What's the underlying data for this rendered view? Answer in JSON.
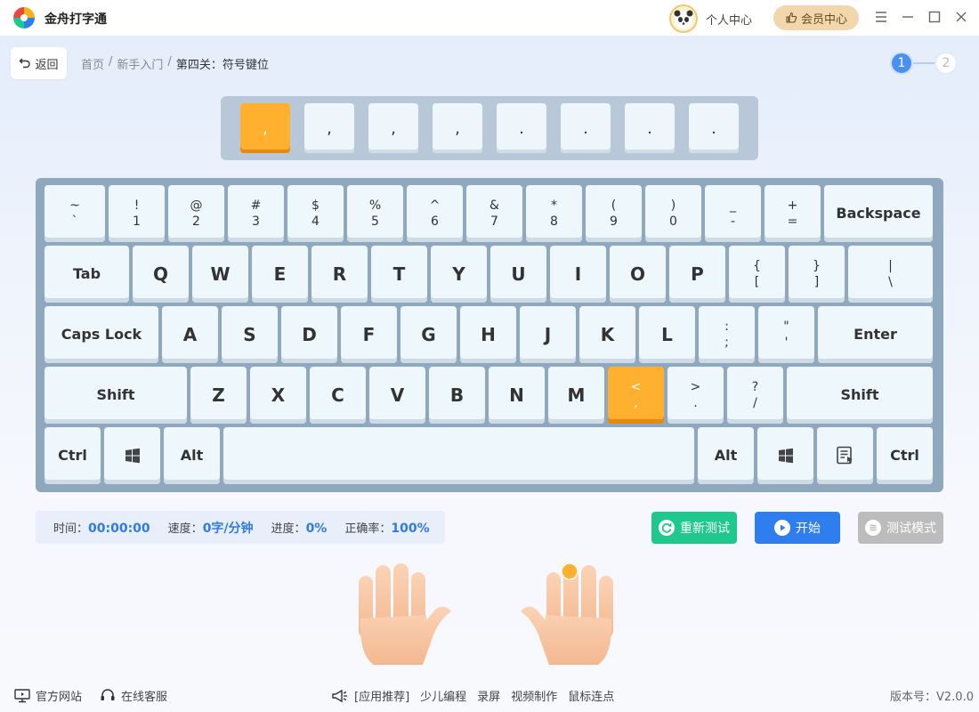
{
  "app": {
    "title": "金舟打字通"
  },
  "header": {
    "personal_label": "个人中心",
    "vip_label": "会员中心"
  },
  "nav": {
    "back_label": "返回",
    "breadcrumb": [
      "首页",
      "/",
      "新手入门",
      "/",
      "第四关：符号键位"
    ],
    "steps": [
      "1",
      "2"
    ],
    "current_step": 1
  },
  "practice": {
    "chars": [
      ",",
      ",",
      ",",
      ",",
      ".",
      ".",
      ".",
      "."
    ],
    "active_index": 0
  },
  "keyboard": {
    "row1": [
      {
        "top": "~",
        "bottom": "`"
      },
      {
        "top": "!",
        "bottom": "1"
      },
      {
        "top": "@",
        "bottom": "2"
      },
      {
        "top": "#",
        "bottom": "3"
      },
      {
        "top": "$",
        "bottom": "4"
      },
      {
        "top": "%",
        "bottom": "5"
      },
      {
        "top": "^",
        "bottom": "6"
      },
      {
        "top": "&",
        "bottom": "7"
      },
      {
        "top": "*",
        "bottom": "8"
      },
      {
        "top": "(",
        "bottom": "9"
      },
      {
        "top": ")",
        "bottom": "0"
      },
      {
        "top": "_",
        "bottom": "-"
      },
      {
        "top": "+",
        "bottom": "="
      },
      {
        "label": "Backspace"
      }
    ],
    "row2": [
      {
        "label": "Tab"
      },
      {
        "label": "Q"
      },
      {
        "label": "W"
      },
      {
        "label": "E"
      },
      {
        "label": "R"
      },
      {
        "label": "T"
      },
      {
        "label": "Y"
      },
      {
        "label": "U"
      },
      {
        "label": "I"
      },
      {
        "label": "O"
      },
      {
        "label": "P"
      },
      {
        "top": "{",
        "bottom": "["
      },
      {
        "top": "}",
        "bottom": "]"
      },
      {
        "top": "|",
        "bottom": "\\"
      }
    ],
    "row3": [
      {
        "label": "Caps Lock"
      },
      {
        "label": "A"
      },
      {
        "label": "S"
      },
      {
        "label": "D"
      },
      {
        "label": "F"
      },
      {
        "label": "G"
      },
      {
        "label": "H"
      },
      {
        "label": "J"
      },
      {
        "label": "K"
      },
      {
        "label": "L"
      },
      {
        "top": ":",
        "bottom": ";"
      },
      {
        "top": "\"",
        "bottom": "'"
      },
      {
        "label": "Enter"
      }
    ],
    "row4": [
      {
        "label": "Shift"
      },
      {
        "label": "Z"
      },
      {
        "label": "X"
      },
      {
        "label": "C"
      },
      {
        "label": "V"
      },
      {
        "label": "B"
      },
      {
        "label": "N"
      },
      {
        "label": "M"
      },
      {
        "top": "<",
        "bottom": ","
      },
      {
        "top": ">",
        "bottom": "."
      },
      {
        "top": "?",
        "bottom": "/"
      },
      {
        "label": "Shift"
      }
    ],
    "row5": [
      {
        "label": "Ctrl"
      },
      {
        "icon": "windows-icon"
      },
      {
        "label": "Alt"
      },
      {
        "label": ""
      },
      {
        "label": "Alt"
      },
      {
        "icon": "windows-icon"
      },
      {
        "icon": "menu-icon"
      },
      {
        "label": "Ctrl"
      }
    ],
    "highlight_key": ","
  },
  "stats": {
    "time_label": "时间：",
    "time_value": "00:00:00",
    "speed_label": "速度：",
    "speed_value": "0字/分钟",
    "progress_label": "进度：",
    "progress_value": "0%",
    "accuracy_label": "正确率：",
    "accuracy_value": "100%"
  },
  "actions": {
    "retest_label": "重新测试",
    "start_label": "开始",
    "mode_label": "测试模式"
  },
  "footer": {
    "website_label": "官方网站",
    "service_label": "在线客服",
    "recommend_label": "[应用推荐]",
    "links": [
      "少儿编程",
      "录屏",
      "视频制作",
      "鼠标连点"
    ],
    "version": "版本号：V2.0.0"
  },
  "colors": {
    "accent": "#2f7ef0",
    "highlight": "#ffb02e",
    "retest": "#1fc88c"
  }
}
